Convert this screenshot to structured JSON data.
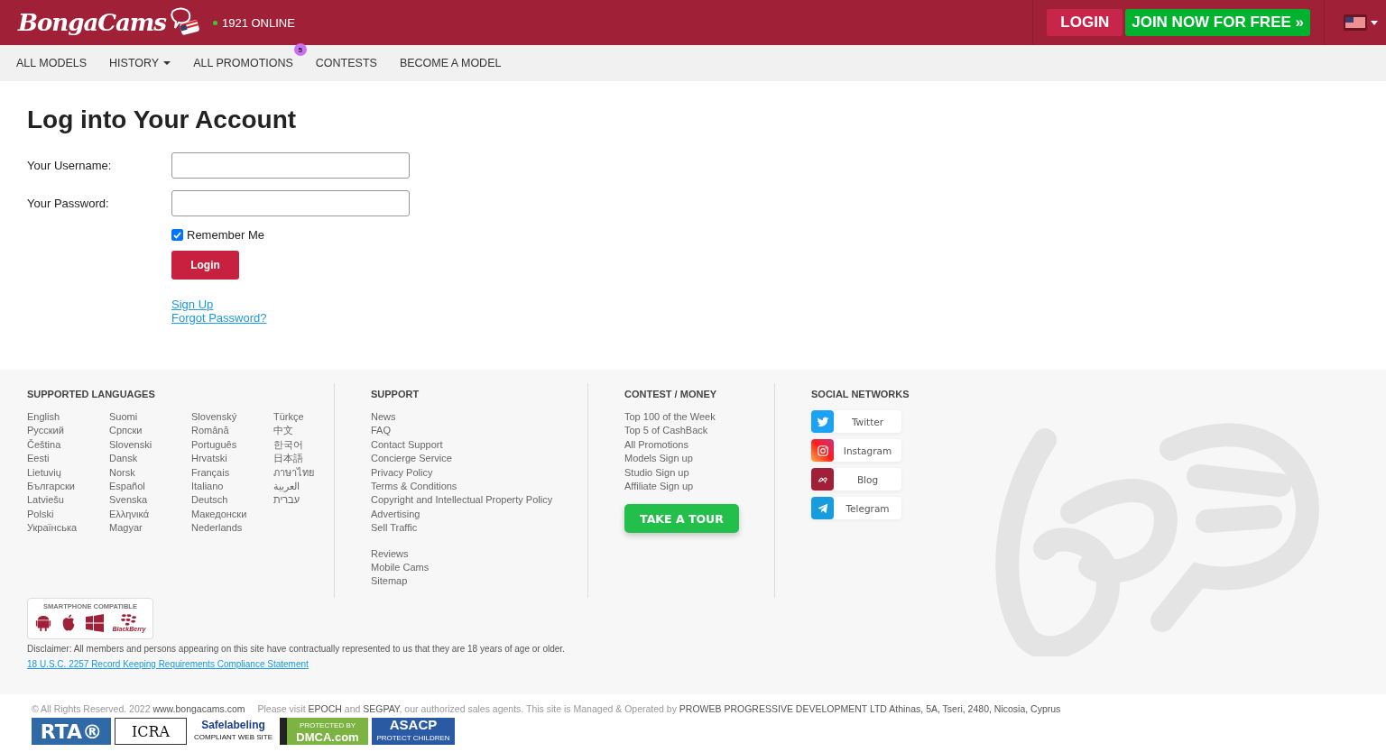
{
  "header": {
    "logo_text": "BongaCams",
    "online": "1921 ONLINE",
    "login_button": "LOGIN",
    "join_button": "JOIN NOW FOR FREE »"
  },
  "nav": [
    {
      "label": "ALL MODELS",
      "dropdown": false
    },
    {
      "label": "HISTORY",
      "dropdown": true
    },
    {
      "label": "ALL PROMOTIONS",
      "dropdown": false,
      "badge": "5"
    },
    {
      "label": "CONTESTS",
      "dropdown": false
    },
    {
      "label": "BECOME A MODEL",
      "dropdown": false
    }
  ],
  "login": {
    "title": "Log into Your Account",
    "fields": [
      {
        "label": "Your Username:"
      },
      {
        "label": "Your Password:"
      }
    ],
    "remember": {
      "label": "Remember Me",
      "checked": true
    },
    "submit": "Login",
    "links": [
      "Sign Up",
      "Forgot Password?"
    ]
  },
  "footer": {
    "languages": {
      "heading": "SUPPORTED LANGUAGES",
      "columns": [
        [
          "English",
          "Русский",
          "Čeština",
          "Eesti",
          "Lietuvių",
          "Български",
          "Latviešu",
          "Polski",
          "Українська"
        ],
        [
          "Suomi",
          "Српски",
          "Slovenski",
          "Dansk",
          "Norsk",
          "Español",
          "Svenska",
          "Ελληνικά",
          "Magyar"
        ],
        [
          "Slovenský",
          "Română",
          "Português",
          "Hrvatski",
          "Français",
          "Italiano",
          "Deutsch",
          "Македонски",
          "Nederlands"
        ],
        [
          "Türkçe",
          "中文",
          "한국어",
          "日本語",
          "ภาษาไทย",
          "العربية",
          "עברית"
        ]
      ]
    },
    "support": {
      "heading": "SUPPORT",
      "groups": [
        [
          "News",
          "FAQ",
          "Contact Support",
          "Concierge Service",
          "Privacy Policy",
          "Terms & Conditions",
          "Copyright and Intellectual Property Policy",
          "Advertising",
          "Sell Traffic"
        ],
        [
          "Reviews",
          "Mobile Cams",
          "Sitemap"
        ]
      ]
    },
    "contest": {
      "heading": "CONTEST / MONEY",
      "links": [
        "Top 100 of the Week",
        "Top 5 of CashBack",
        "All Promotions",
        "Models Sign up",
        "Studio Sign up",
        "Affiliate Sign up"
      ],
      "tour_button": "TAKE A TOUR"
    },
    "social": {
      "heading": "SOCIAL NETWORKS",
      "items": [
        {
          "label": "Twitter",
          "kind": "twitter"
        },
        {
          "label": "Instagram",
          "kind": "instagram"
        },
        {
          "label": "Blog",
          "kind": "blog"
        },
        {
          "label": "Telegram",
          "kind": "telegram"
        }
      ]
    },
    "smartphone": {
      "heading": "SMARTPHONE COMPATIBLE",
      "platforms": [
        {
          "kind": "android"
        },
        {
          "kind": "apple"
        },
        {
          "kind": "windows"
        },
        {
          "kind": "blackberry",
          "label": "BlackBerry"
        }
      ]
    },
    "disclaimer": "Disclaimer: All members and persons appearing on this site have contractually represented to us that they are 18 years of age or older.",
    "compliance_link": "18 U.S.C. 2257 Record Keeping Requirements Compliance Statement",
    "copyright": [
      {
        "text": "© All Rights Reserved. 2022 ",
        "strong": false
      },
      {
        "text": "www.bongacams.com",
        "strong": true
      }
    ],
    "notice": [
      {
        "text": "Please visit ",
        "strong": false
      },
      {
        "text": "EPOCH",
        "strong": true
      },
      {
        "text": " and ",
        "strong": false
      },
      {
        "text": "SEGPAY",
        "strong": true
      },
      {
        "text": ", our authorized sales agents. This site is Managed & Operated by ",
        "strong": false
      },
      {
        "text": "PROWEB PROGRESSIVE DEVELOPMENT LTD Athinas, 5A, Tseri, 2480, Nicosia, Cyprus",
        "strong": true
      }
    ],
    "badges": [
      {
        "kind": "rta",
        "label": "RTA®"
      },
      {
        "kind": "icra",
        "label": "ICRA"
      },
      {
        "kind": "safe",
        "label": "Safelabeling",
        "sub": "COMPLIANT WEB SITE"
      },
      {
        "kind": "dmca",
        "label": "DMCA.com",
        "sub": "PROTECTED BY"
      },
      {
        "kind": "asacp",
        "label": "ASACP",
        "sub": "PROTECT CHILDREN"
      }
    ]
  }
}
